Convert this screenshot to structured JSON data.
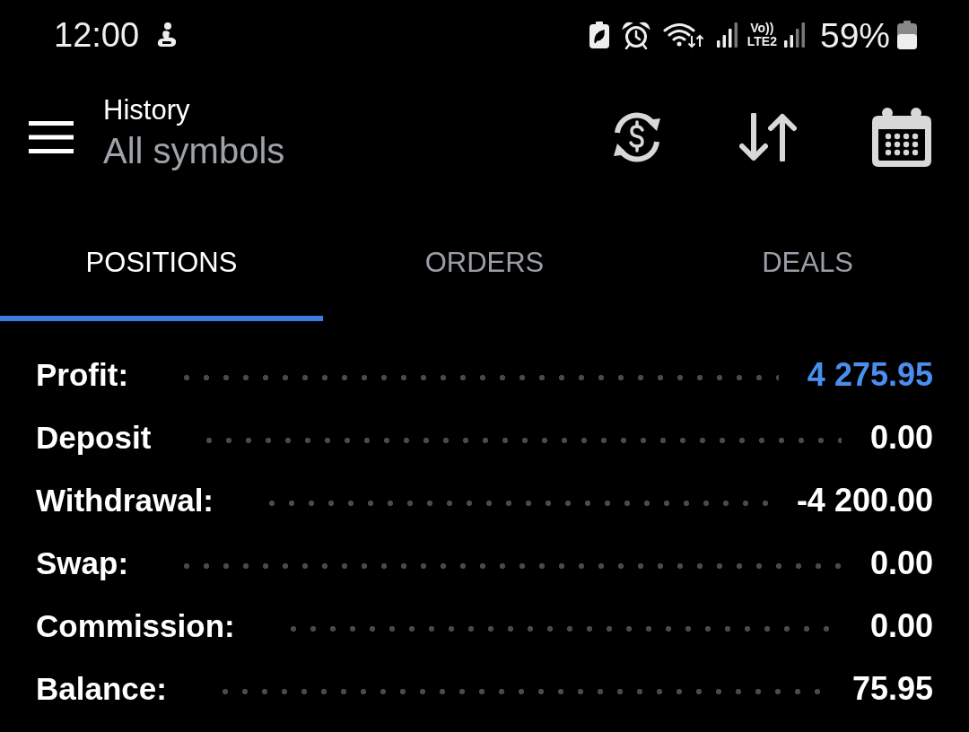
{
  "status_bar": {
    "time": "12:00",
    "network_label": [
      "Vo))",
      "LTE2"
    ],
    "battery": "59%"
  },
  "header": {
    "title": "History",
    "subtitle": "All symbols"
  },
  "tabs": [
    {
      "label": "POSITIONS",
      "selected": true
    },
    {
      "label": "ORDERS",
      "selected": false
    },
    {
      "label": "DEALS",
      "selected": false
    }
  ],
  "summary": [
    {
      "label": "Profit:",
      "value": "4 275.95",
      "color": "#4a8ff0"
    },
    {
      "label": "Deposit",
      "value": "0.00",
      "color": "#ffffff"
    },
    {
      "label": "Withdrawal:",
      "value": "-4 200.00",
      "color": "#ffffff"
    },
    {
      "label": "Swap:",
      "value": "0.00",
      "color": "#ffffff"
    },
    {
      "label": "Commission:",
      "value": "0.00",
      "color": "#ffffff"
    },
    {
      "label": "Balance:",
      "value": "75.95",
      "color": "#ffffff"
    }
  ]
}
